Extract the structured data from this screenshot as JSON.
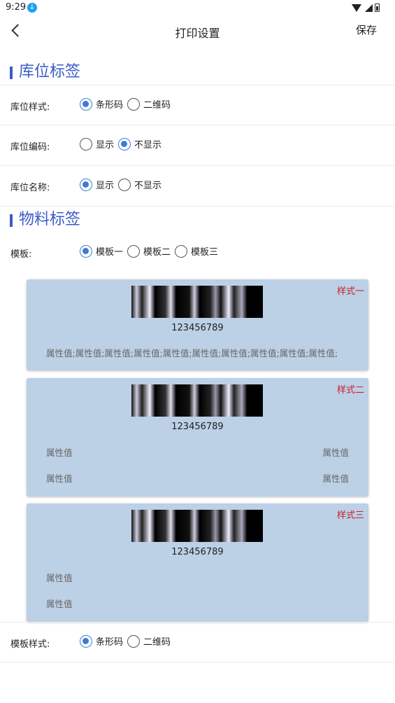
{
  "status_bar": {
    "time": "9:29",
    "download_icon": "download-icon"
  },
  "nav": {
    "title": "打印设置",
    "save_label": "保存",
    "back_icon": "chevron-left-icon"
  },
  "section_location": {
    "title": "库位标签",
    "rows": [
      {
        "label": "库位样式:",
        "options": [
          "条形码",
          "二维码"
        ],
        "selected": 0
      },
      {
        "label": "库位编码:",
        "options": [
          "显示",
          "不显示"
        ],
        "selected": 1
      },
      {
        "label": "库位名称:",
        "options": [
          "显示",
          "不显示"
        ],
        "selected": 0
      }
    ]
  },
  "section_material": {
    "title": "物料标签",
    "template_row": {
      "label": "模板:",
      "options": [
        "模板一",
        "模板二",
        "模板三"
      ],
      "selected": 0
    },
    "cards": [
      {
        "tag": "样式一",
        "barcode_number": "123456789",
        "attr_line": "属性值;属性值;属性值;属性值;属性值;属性值;属性值;属性值;属性值;属性值;"
      },
      {
        "tag": "样式二",
        "barcode_number": "123456789",
        "attr_left_1": "属性值",
        "attr_right_1": "属性值",
        "attr_left_2": "属性值",
        "attr_right_2": "属性值"
      },
      {
        "tag": "样式三",
        "barcode_number": "123456789",
        "attr_1": "属性值",
        "attr_2": "属性值"
      }
    ],
    "style_row": {
      "label": "模板样式:",
      "options": [
        "条形码",
        "二维码"
      ],
      "selected": 0
    }
  },
  "colors": {
    "accent": "#3a5bc7",
    "radio_on": "#3f7bd6",
    "tag_red": "#c8202f",
    "card_bg": "#bcd0e6"
  }
}
